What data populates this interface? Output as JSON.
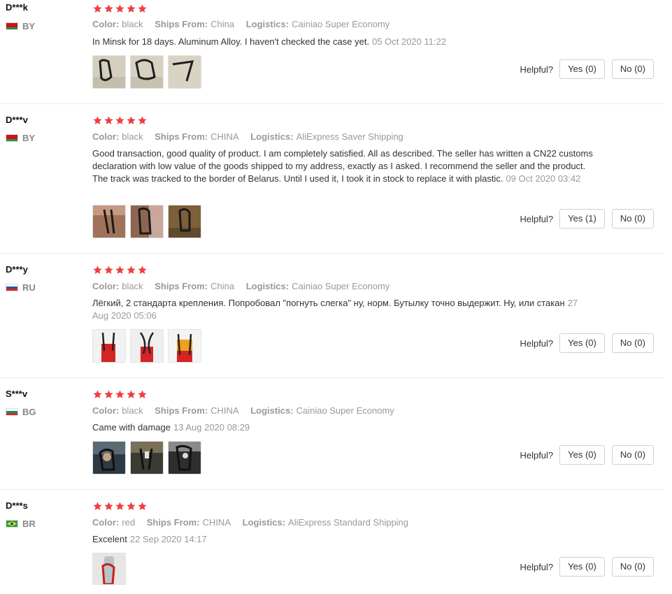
{
  "labels": {
    "color": "Color:",
    "ships_from": "Ships From:",
    "logistics": "Logistics:",
    "helpful": "Helpful?"
  },
  "star_color": "#f03e3e",
  "rating_max": 5,
  "reviews": [
    {
      "name": "D***k",
      "country": "BY",
      "flag": "belarus-flag",
      "rating": 5,
      "color": "black",
      "ships_from": "China",
      "logistics": "Cainiao Super Economy",
      "text": "In Minsk for 18 days. Aluminum Alloy. I haven't checked the case yet.",
      "date": "05 Oct 2020 11:22",
      "photo_count": 3,
      "yes": "Yes (0)",
      "no": "No (0)"
    },
    {
      "name": "D***v",
      "country": "BY",
      "flag": "belarus-flag",
      "rating": 5,
      "color": "black",
      "ships_from": "CHINA",
      "logistics": "AliExpress Saver Shipping",
      "text": "Good transaction, good quality of product. I am completely satisfied. All as described. The seller has written a CN22 customs declaration with low value of the goods shipped to my address, exactly as I asked. I recommend the seller and the product. The track was tracked to the border of Belarus. Until I used it, I took it in stock to replace it with plastic.",
      "date": "09 Oct 2020 03:42",
      "photo_count": 3,
      "yes": "Yes (1)",
      "no": "No (0)"
    },
    {
      "name": "D***y",
      "country": "RU",
      "flag": "russia-flag",
      "rating": 5,
      "color": "black",
      "ships_from": "China",
      "logistics": "Cainiao Super Economy",
      "text": "Лёгкий, 2 стандарта крепления. Попробовал \"погнуть слегка\" ну, норм. Бутылку точно выдержит. Ну, или стакан",
      "date": "27 Aug 2020 05:06",
      "photo_count": 3,
      "yes": "Yes (0)",
      "no": "No (0)"
    },
    {
      "name": "S***v",
      "country": "BG",
      "flag": "bulgaria-flag",
      "rating": 5,
      "color": "black",
      "ships_from": "CHINA",
      "logistics": "Cainiao Super Economy",
      "text": "Came with damage",
      "date": "13 Aug 2020 08:29",
      "photo_count": 3,
      "yes": "Yes (0)",
      "no": "No (0)"
    },
    {
      "name": "D***s",
      "country": "BR",
      "flag": "brazil-flag",
      "rating": 5,
      "color": "red",
      "ships_from": "CHINA",
      "logistics": "AliExpress Standard Shipping",
      "text": "Excelent",
      "date": "22 Sep 2020 14:17",
      "photo_count": 1,
      "yes": "Yes (0)",
      "no": "No (0)"
    }
  ]
}
